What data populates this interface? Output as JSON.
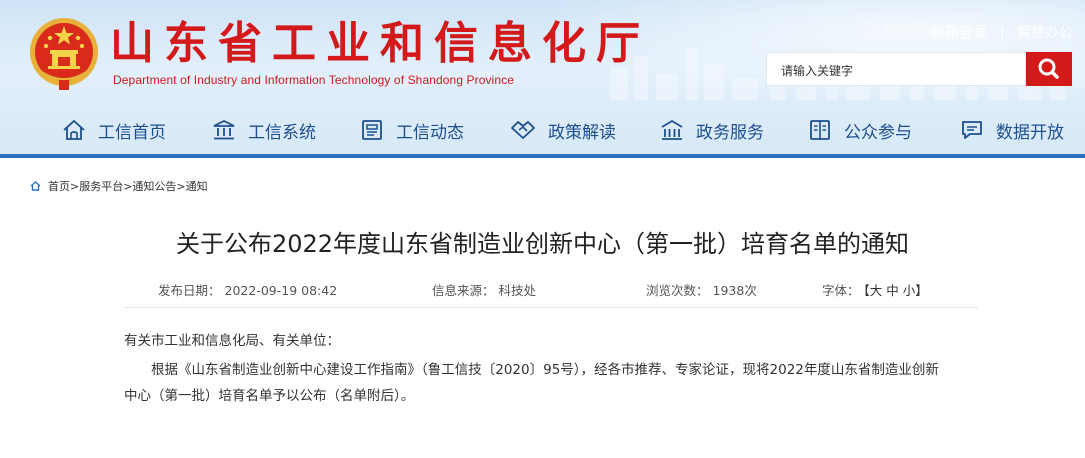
{
  "header": {
    "title_cn": "山东省工业和信息化厅",
    "title_en": "Department of Industry and Information Technology of Shandong Province",
    "links": [
      "邮箱登录",
      "智慧办公"
    ],
    "separator": "|",
    "search_placeholder": "请输入关键字"
  },
  "nav": {
    "items": [
      {
        "label": "工信首页",
        "icon": "home-icon"
      },
      {
        "label": "工信系统",
        "icon": "institution-icon"
      },
      {
        "label": "工信动态",
        "icon": "news-icon"
      },
      {
        "label": "政策解读",
        "icon": "handshake-icon"
      },
      {
        "label": "政务服务",
        "icon": "building-icon"
      },
      {
        "label": "公众参与",
        "icon": "book-icon"
      },
      {
        "label": "数据开放",
        "icon": "chat-icon"
      }
    ]
  },
  "breadcrumb": "首页>服务平台>通知公告>通知",
  "article": {
    "title": "关于公布2022年度山东省制造业创新中心（第一批）培育名单的通知",
    "meta": {
      "date_label": "发布日期：",
      "date": "2022-09-19 08:42",
      "source_label": "信息来源：",
      "source": "科技处",
      "views_label": "浏览次数：",
      "views": "1938次",
      "font_label": "字体：",
      "font_options": "【大 中 小】"
    },
    "salutation": "有关市工业和信息化局、有关单位：",
    "paragraph_line1": "根据《山东省制造业创新中心建设工作指南》（鲁工信技〔2020〕95号），经各市推荐、专家论证，现将2022年度山东省制造业创新",
    "paragraph_line2": "中心（第一批）培育名单予以公布（名单附后）。"
  },
  "colors": {
    "brand_red": "#d4191b",
    "nav_blue": "#1e4f8f",
    "header_line": "#2a72bd"
  }
}
